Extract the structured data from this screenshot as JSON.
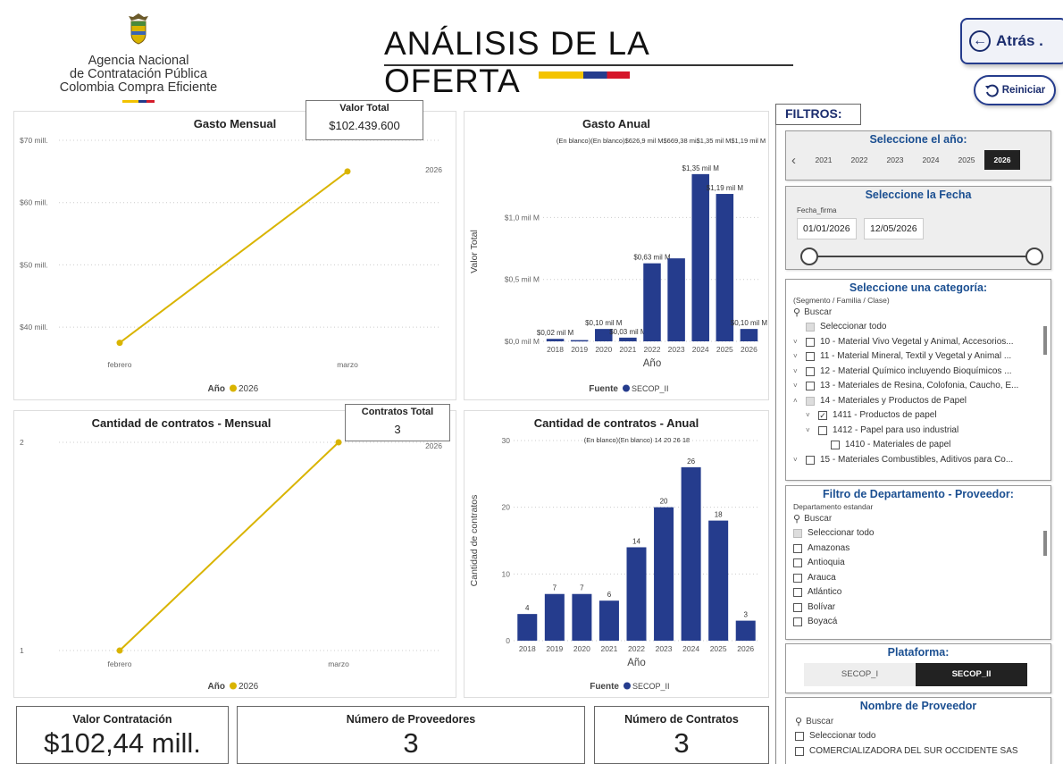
{
  "header": {
    "org_line1": "Agencia Nacional",
    "org_line2": "de Contratación Pública",
    "org_line3": "Colombia Compra Eficiente",
    "title": "ANÁLISIS DE LA OFERTA",
    "back_label": "Atrás .",
    "reset_label": "Reiniciar"
  },
  "colors": {
    "navy": "#253c8d",
    "gold": "#d9b400",
    "accent_blue": "#1b4f91"
  },
  "kpi": {
    "valor_total_label": "Valor Total",
    "valor_total_value": "$102.439.600",
    "contratos_total_label": "Contratos Total",
    "contratos_total_value": "3"
  },
  "bottom": {
    "valor_label": "Valor Contratación",
    "valor_value": "$102,44 mill.",
    "prov_label": "Número de Proveedores",
    "prov_value": "3",
    "contr_label": "Número de Contratos",
    "contr_value": "3"
  },
  "chart_data": [
    {
      "type": "line",
      "title": "Gasto Mensual",
      "categories": [
        "febrero",
        "marzo"
      ],
      "series": [
        {
          "name": "2026",
          "values": [
            37.5,
            65
          ]
        }
      ],
      "yticks": [
        "$70 mill.",
        "$60 mill.",
        "$50 mill.",
        "$40 mill."
      ],
      "ytick_values": [
        70,
        60,
        50,
        40
      ],
      "ylim": [
        33,
        72
      ],
      "legend_title": "Año",
      "end_label": "2026"
    },
    {
      "type": "bar",
      "title": "Gasto Anual",
      "subtitle": "(En blanco)(En blanco)$626,9 mil M$669,38 mi$1,35 mil M$1,19 mil M",
      "xlabel": "Año",
      "ylabel": "Valor Total",
      "categories": [
        "2018",
        "2019",
        "2020",
        "2021",
        "2022",
        "2023",
        "2024",
        "2025",
        "2026"
      ],
      "values": [
        0.02,
        0.01,
        0.1,
        0.03,
        0.63,
        0.67,
        1.35,
        1.19,
        0.1
      ],
      "data_labels": [
        "$0,02 mil M",
        "",
        "$0,10 mil M",
        "$0,03 mil M",
        "$0,63 mil M",
        "",
        "$1,35 mil M",
        "$1,19 mil M",
        "$0,10 mil M"
      ],
      "yticks": [
        "$1,0 mil M",
        "$0,5 mil M",
        "$0,0 mil M"
      ],
      "ytick_values": [
        1.0,
        0.5,
        0.0
      ],
      "ylim": [
        0,
        1.45
      ],
      "legend_title": "Fuente",
      "legend": "SECOP_II"
    },
    {
      "type": "line",
      "title": "Cantidad de contratos - Mensual",
      "categories": [
        "febrero",
        "marzo"
      ],
      "series": [
        {
          "name": "2026",
          "values": [
            1,
            2
          ]
        }
      ],
      "yticks": [
        "2",
        "1"
      ],
      "ytick_values": [
        2,
        1
      ],
      "ylim": [
        1,
        2
      ],
      "legend_title": "Año",
      "end_label": "2026"
    },
    {
      "type": "bar",
      "title": "Cantidad de contratos - Anual",
      "subtitle": "(En blanco)(En blanco)   14          20          26          18",
      "xlabel": "Año",
      "ylabel": "Cantidad de contratos",
      "categories": [
        "2018",
        "2019",
        "2020",
        "2021",
        "2022",
        "2023",
        "2024",
        "2025",
        "2026"
      ],
      "values": [
        4,
        7,
        7,
        6,
        14,
        20,
        26,
        18,
        3
      ],
      "data_labels": [
        "4",
        "7",
        "7",
        "6",
        "14",
        "20",
        "26",
        "18",
        "3"
      ],
      "yticks": [
        "30",
        "20",
        "10",
        "0"
      ],
      "ytick_values": [
        30,
        20,
        10,
        0
      ],
      "ylim": [
        0,
        30
      ],
      "legend_title": "Fuente",
      "legend": "SECOP_II"
    }
  ],
  "filters": {
    "label": "FILTROS:",
    "year": {
      "title": "Seleccione el año:",
      "years": [
        "2021",
        "2022",
        "2023",
        "2024",
        "2025",
        "2026"
      ],
      "selected": "2026"
    },
    "date": {
      "title": "Seleccione la Fecha",
      "field": "Fecha_firma",
      "from": "01/01/2026",
      "to": "12/05/2026"
    },
    "category": {
      "title": "Seleccione una categoría:",
      "subtitle": "(Segmento / Familia / Clase)",
      "search": "Buscar",
      "select_all": "Seleccionar todo",
      "items": [
        "10 - Material Vivo Vegetal y Animal, Accesorios...",
        "11 - Material Mineral, Textil y Vegetal y Animal ...",
        "12 - Material Químico incluyendo Bioquímicos ...",
        "13 - Materiales de Resina, Colofonia, Caucho, E...",
        "14 - Materiales y Productos de Papel",
        "1411 - Productos de papel",
        "1412 - Papel para uso industrial",
        "1410 - Materiales de papel",
        "15 - Materiales Combustibles, Aditivos para Co..."
      ]
    },
    "department": {
      "title": "Filtro de Departamento - Proveedor:",
      "field": "Departamento estandar",
      "search": "Buscar",
      "select_all": "Seleccionar todo",
      "items": [
        "Amazonas",
        "Antioquia",
        "Arauca",
        "Atlántico",
        "Bolívar",
        "Boyacá"
      ]
    },
    "platform": {
      "title": "Plataforma:",
      "options": [
        "SECOP_I",
        "SECOP_II"
      ],
      "selected": "SECOP_II"
    },
    "provider": {
      "title": "Nombre de Proveedor",
      "search": "Buscar",
      "select_all": "Seleccionar todo",
      "items": [
        "COMERCIALIZADORA DEL SUR OCCIDENTE SAS"
      ]
    }
  }
}
